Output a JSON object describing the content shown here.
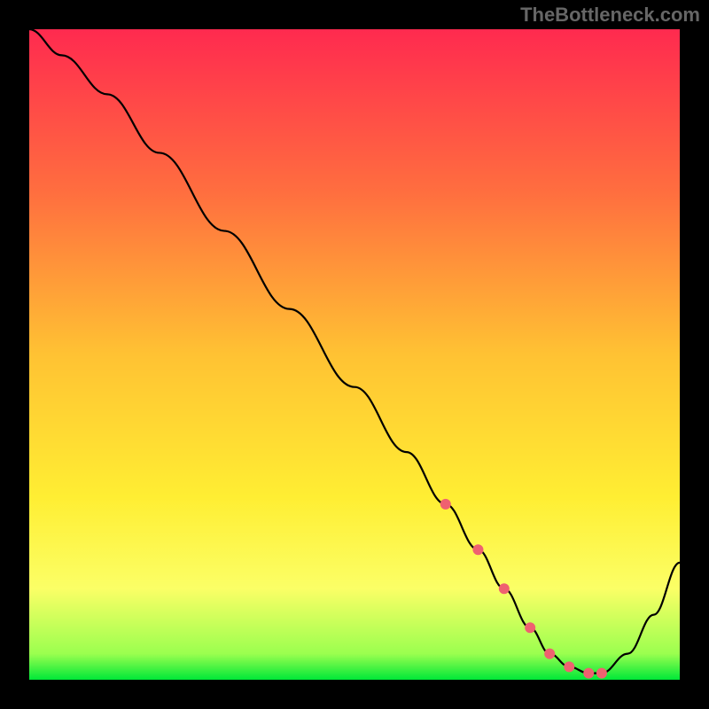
{
  "watermark": "TheBottleneck.com",
  "chart_data": {
    "type": "line",
    "title": "",
    "xlabel": "",
    "ylabel": "",
    "xlim": [
      0,
      100
    ],
    "ylim": [
      0,
      100
    ],
    "grid": false,
    "gradient_stops": [
      {
        "offset": 0,
        "color": "#ff2a4f"
      },
      {
        "offset": 25,
        "color": "#ff6e3f"
      },
      {
        "offset": 50,
        "color": "#ffc233"
      },
      {
        "offset": 72,
        "color": "#ffee33"
      },
      {
        "offset": 86,
        "color": "#fbff66"
      },
      {
        "offset": 96,
        "color": "#9bff4f"
      },
      {
        "offset": 100,
        "color": "#00e838"
      }
    ],
    "series": [
      {
        "name": "bottleneck-curve",
        "color": "#000000",
        "x": [
          0,
          5,
          12,
          20,
          30,
          40,
          50,
          58,
          64,
          69,
          73,
          77,
          80,
          83,
          86,
          88,
          92,
          96,
          100
        ],
        "y": [
          100,
          96,
          90,
          81,
          69,
          57,
          45,
          35,
          27,
          20,
          14,
          8,
          4,
          2,
          1,
          1,
          4,
          10,
          18
        ]
      }
    ],
    "highlight_points": {
      "color": "#ef6170",
      "radius": 6,
      "x": [
        64,
        69,
        73,
        77,
        80,
        83,
        86,
        88
      ],
      "y": [
        27,
        20,
        14,
        8,
        4,
        2,
        1,
        1
      ]
    }
  }
}
